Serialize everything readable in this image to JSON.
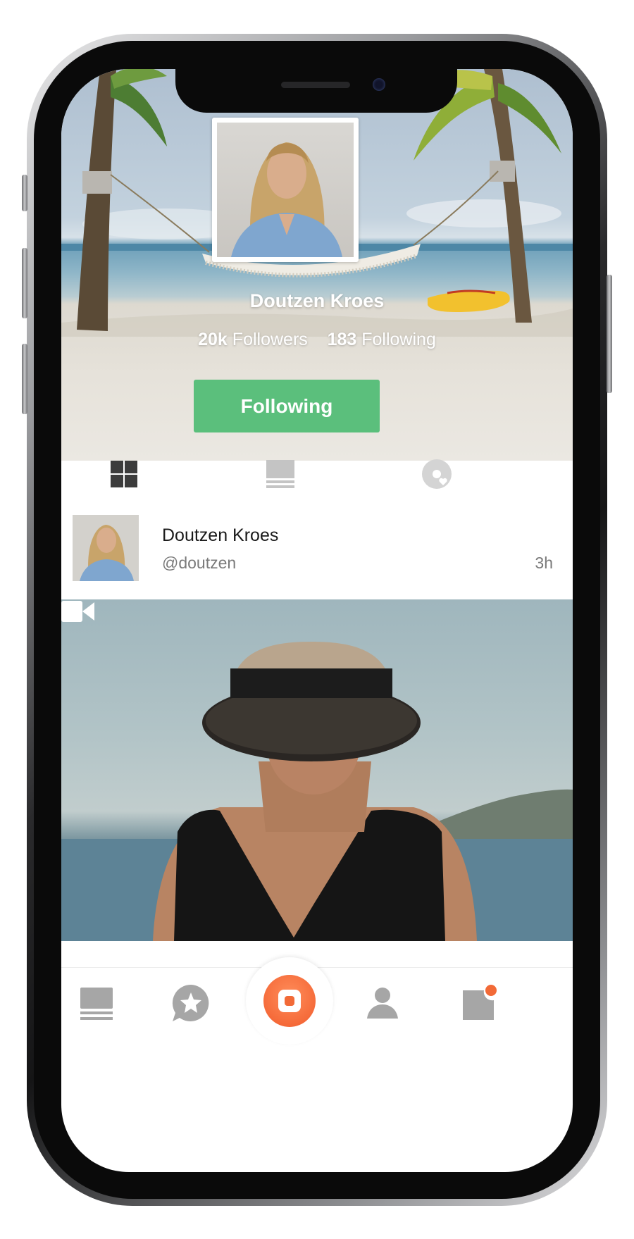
{
  "profile": {
    "name": "Doutzen Kroes",
    "followers_count": "20k",
    "followers_label": "Followers",
    "following_count": "183",
    "following_label": "Following",
    "follow_button_label": "Following"
  },
  "tabs": [
    {
      "icon": "grid-icon",
      "active": true
    },
    {
      "icon": "list-feed-icon",
      "active": false
    },
    {
      "icon": "tagged-icon",
      "active": false
    }
  ],
  "post": {
    "author_name": "Doutzen Kroes",
    "author_handle": "@doutzen",
    "time": "3h",
    "media_type_icon": "video-camera-icon"
  },
  "bottom_nav": [
    {
      "icon": "feed-icon"
    },
    {
      "icon": "star-chat-icon"
    },
    {
      "icon": "record-icon"
    },
    {
      "icon": "profile-icon"
    },
    {
      "icon": "notifications-icon",
      "badge": true
    }
  ],
  "colors": {
    "follow_button": "#5bbf7c",
    "record_button": "#f15c2c",
    "icon_inactive": "#b3b3b3",
    "icon_active": "#3c3c3c"
  }
}
